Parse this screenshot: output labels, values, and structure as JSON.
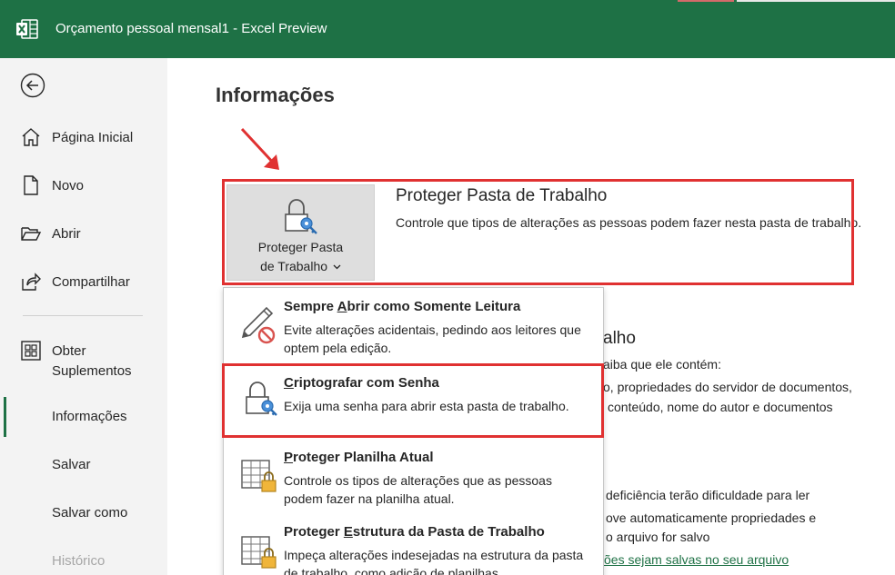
{
  "window": {
    "title": "Orçamento pessoal mensal1  -  Excel Preview",
    "app_icon": "excel-icon",
    "accent": "#1e7145"
  },
  "sidebar": {
    "back_icon": "back-arrow-icon",
    "items": [
      {
        "label": "Página Inicial",
        "icon": "home-icon"
      },
      {
        "label": "Novo",
        "icon": "new-document-icon"
      },
      {
        "label": "Abrir",
        "icon": "open-folder-icon"
      },
      {
        "label": "Compartilhar",
        "icon": "share-icon"
      },
      {
        "label_line1": "Obter",
        "label_line2": "Suplementos",
        "icon": "addins-icon"
      },
      {
        "label": "Informações",
        "active": true
      },
      {
        "label": "Salvar"
      },
      {
        "label": "Salvar como"
      },
      {
        "label": "Histórico",
        "disabled": true
      }
    ]
  },
  "main": {
    "page_title": "Informações",
    "protect_button": {
      "line1": "Proteger Pasta",
      "line2": "de Trabalho",
      "chevron": "chevron-down-icon",
      "icon": "lock-key-icon"
    },
    "protect_section": {
      "title": "Proteger Pasta de Trabalho",
      "description": "Controle que tipos de alterações as pessoas podem fazer nesta pasta de trabalho."
    },
    "background": {
      "heading_fragment": "alho",
      "line1": "aiba que ele contém:",
      "line2": "o, propriedades do servidor de documentos,",
      "line3": "conteúdo, nome do autor e documentos",
      "line4": "deficiência terão dificuldade para ler",
      "line5": "ove automaticamente propriedades e",
      "line6": "o arquivo for salvo",
      "link": "ões sejam salvas no seu arquivo"
    },
    "dropdown": {
      "items": [
        {
          "title_prefix": "Sempre ",
          "title_access": "A",
          "title_rest": "brir como Somente Leitura",
          "description": "Evite alterações acidentais, pedindo aos leitores que optem pela edição.",
          "icon": "pencil-no-edit-icon"
        },
        {
          "title_prefix": "",
          "title_access": "C",
          "title_rest": "riptografar com Senha",
          "description": "Exija uma senha para abrir esta pasta de trabalho.",
          "icon": "lock-key-icon"
        },
        {
          "title_prefix": "",
          "title_access": "P",
          "title_rest": "roteger Planilha Atual",
          "description": "Controle os tipos de alterações que as pessoas podem fazer na planilha atual.",
          "icon": "sheet-lock-icon"
        },
        {
          "title_prefix": "Proteger ",
          "title_access": "E",
          "title_rest": "strutura da Pasta de Trabalho",
          "description": "Impeça alterações indesejadas na estrutura da pasta de trabalho, como adição de planilhas.",
          "icon": "workbook-lock-icon"
        }
      ]
    },
    "annotation_color": "#e03131"
  }
}
